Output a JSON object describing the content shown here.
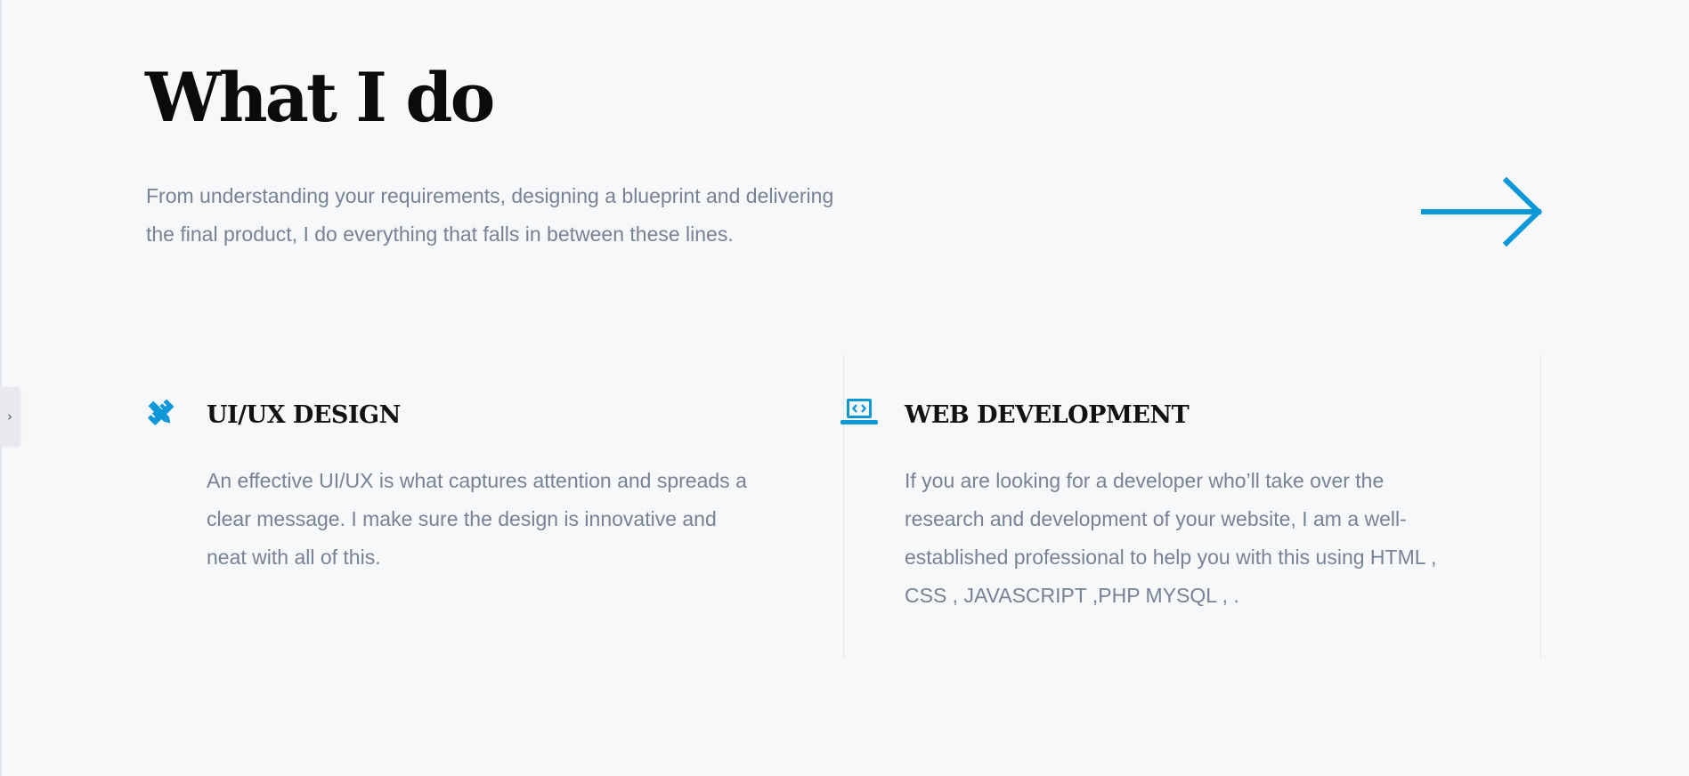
{
  "colors": {
    "accent": "#0f98d8",
    "background": "#f6f8fa",
    "heading": "#0b0b0b",
    "body_text": "#778295"
  },
  "side_toggle": {
    "glyph": "›",
    "icon": "chevron-right-icon"
  },
  "section": {
    "title": "What I do",
    "intro": "From understanding your requirements, designing a blueprint and delivering the final product, I do everything that falls in between these lines.",
    "arrow_icon": "arrow-right-icon"
  },
  "services": [
    {
      "icon": "pencil-ruler-icon",
      "title": "UI/UX DESIGN",
      "description": "An effective UI/UX is what captures attention and spreads a clear message. I make sure the design is innovative and neat with all of this."
    },
    {
      "icon": "laptop-code-icon",
      "title": "WEB DEVELOPMENT",
      "description": "If you are looking for a developer who’ll take over the research and development of your website, I am a well-established professional to help you with this using HTML , CSS , JAVASCRIPT ,PHP MYSQL , ."
    }
  ]
}
